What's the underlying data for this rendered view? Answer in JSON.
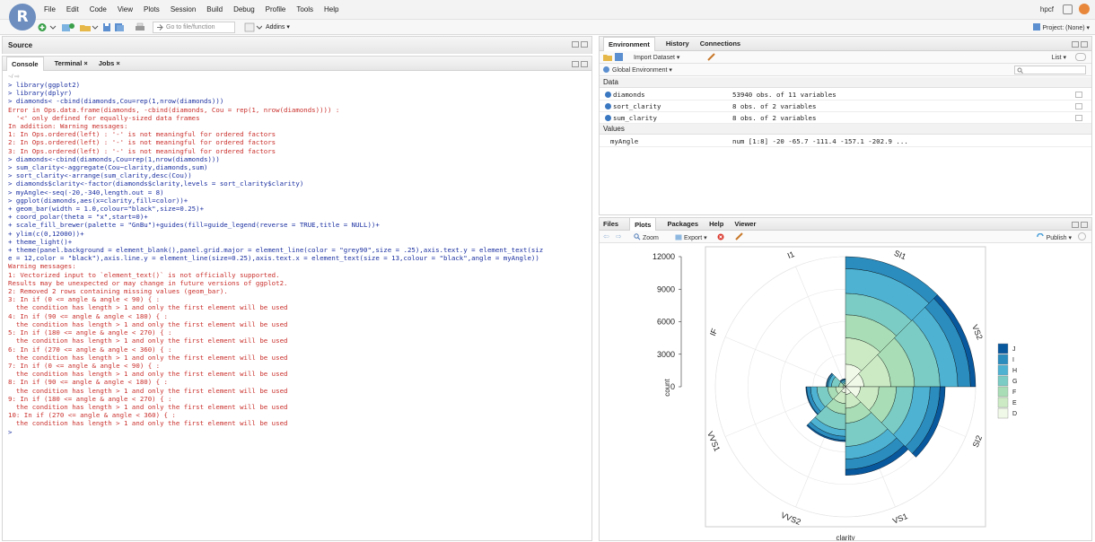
{
  "app": {
    "logo_letter": "R"
  },
  "menubar": {
    "items": [
      "File",
      "Edit",
      "Code",
      "View",
      "Plots",
      "Session",
      "Build",
      "Debug",
      "Profile",
      "Tools",
      "Help"
    ],
    "user": "hpcf"
  },
  "toolbar": {
    "goto_placeholder": "Go to file/function",
    "addins_label": "Addins ▾",
    "project_label": "Project: (None) ▾"
  },
  "source_pane": {
    "title": "Source"
  },
  "console_pane": {
    "tabs": [
      "Console",
      "Terminal ×",
      "Jobs ×"
    ],
    "path": "~/ ⇨",
    "lines": [
      {
        "t": "> library(ggplot2)",
        "c": "cmd"
      },
      {
        "t": "> library(dplyr)",
        "c": "cmd"
      },
      {
        "t": "> diamonds< -cbind(diamonds,Cou=rep(1,nrow(diamonds)))",
        "c": "cmd"
      },
      {
        "t": "Error in Ops.data.frame(diamonds, -cbind(diamonds, Cou = rep(1, nrow(diamonds)))) :",
        "c": "err"
      },
      {
        "t": "  '<' only defined for equally-sized data frames",
        "c": "err"
      },
      {
        "t": "In addition: Warning messages:",
        "c": "err"
      },
      {
        "t": "1: In Ops.ordered(left) : '-' is not meaningful for ordered factors",
        "c": "err"
      },
      {
        "t": "2: In Ops.ordered(left) : '-' is not meaningful for ordered factors",
        "c": "err"
      },
      {
        "t": "3: In Ops.ordered(left) : '-' is not meaningful for ordered factors",
        "c": "err"
      },
      {
        "t": "> diamonds<-cbind(diamonds,Cou=rep(1,nrow(diamonds)))",
        "c": "cmd"
      },
      {
        "t": "> sum_clarity<-aggregate(Cou~clarity,diamonds,sum)",
        "c": "cmd"
      },
      {
        "t": "> sort_clarity<-arrange(sum_clarity,desc(Cou))",
        "c": "cmd"
      },
      {
        "t": "> diamonds$clarity<-factor(diamonds$clarity,levels = sort_clarity$clarity)",
        "c": "cmd"
      },
      {
        "t": "> myAngle<-seq(-20,-340,length.out = 8)",
        "c": "cmd"
      },
      {
        "t": "> ggplot(diamonds,aes(x=clarity,fill=color))+",
        "c": "cmd"
      },
      {
        "t": "+ geom_bar(width = 1.0,colour=\"black\",size=0.25)+",
        "c": "cmd"
      },
      {
        "t": "+ coord_polar(theta = \"x\",start=0)+",
        "c": "cmd"
      },
      {
        "t": "+ scale_fill_brewer(palette = \"GnBu\")+guides(fill=guide_legend(reverse = TRUE,title = NULL))+",
        "c": "cmd"
      },
      {
        "t": "+ ylim(c(0,12000))+",
        "c": "cmd"
      },
      {
        "t": "+ theme_light()+",
        "c": "cmd"
      },
      {
        "t": "+ theme(panel.background = element_blank(),panel.grid.major = element_line(color = \"grey90\",size = .25),axis.text.y = element_text(siz",
        "c": "cmd"
      },
      {
        "t": "e = 12,color = \"black\"),axis.line.y = element_line(size=0.25),axis.text.x = element_text(size = 13,colour = \"black\",angle = myAngle))",
        "c": "cmd"
      },
      {
        "t": "Warning messages:",
        "c": "err"
      },
      {
        "t": "1: Vectorized input to `element_text()` is not officially supported.",
        "c": "err"
      },
      {
        "t": "Results may be unexpected or may change in future versions of ggplot2.",
        "c": "err"
      },
      {
        "t": "2: Removed 2 rows containing missing values (geom_bar).",
        "c": "err"
      },
      {
        "t": "3: In if (0 <= angle & angle < 90) { :",
        "c": "err"
      },
      {
        "t": "  the condition has length > 1 and only the first element will be used",
        "c": "err"
      },
      {
        "t": "4: In if (90 <= angle & angle < 180) { :",
        "c": "err"
      },
      {
        "t": "  the condition has length > 1 and only the first element will be used",
        "c": "err"
      },
      {
        "t": "5: In if (180 <= angle & angle < 270) { :",
        "c": "err"
      },
      {
        "t": "  the condition has length > 1 and only the first element will be used",
        "c": "err"
      },
      {
        "t": "6: In if (270 <= angle & angle < 360) { :",
        "c": "err"
      },
      {
        "t": "  the condition has length > 1 and only the first element will be used",
        "c": "err"
      },
      {
        "t": "7: In if (0 <= angle & angle < 90) { :",
        "c": "err"
      },
      {
        "t": "  the condition has length > 1 and only the first element will be used",
        "c": "err"
      },
      {
        "t": "8: In if (90 <= angle & angle < 180) { :",
        "c": "err"
      },
      {
        "t": "  the condition has length > 1 and only the first element will be used",
        "c": "err"
      },
      {
        "t": "9: In if (180 <= angle & angle < 270) { :",
        "c": "err"
      },
      {
        "t": "  the condition has length > 1 and only the first element will be used",
        "c": "err"
      },
      {
        "t": "10: In if (270 <= angle & angle < 360) { :",
        "c": "err"
      },
      {
        "t": "  the condition has length > 1 and only the first element will be used",
        "c": "err"
      },
      {
        "t": ">",
        "c": "cursor"
      }
    ]
  },
  "env_pane": {
    "tabs": [
      "Environment",
      "History",
      "Connections"
    ],
    "import_label": "Import Dataset ▾",
    "list_label": "List ▾",
    "scope_label": "Global Environment ▾",
    "data_heading": "Data",
    "values_heading": "Values",
    "data_rows": [
      {
        "name": "diamonds",
        "value": "53940 obs. of 11 variables"
      },
      {
        "name": "sort_clarity",
        "value": "8 obs. of 2 variables"
      },
      {
        "name": "sum_clarity",
        "value": "8 obs. of 2 variables"
      }
    ],
    "value_rows": [
      {
        "name": "myAngle",
        "value": "num [1:8] -20 -65.7 -111.4 -157.1 -202.9 ..."
      }
    ]
  },
  "plots_pane": {
    "tabs": [
      "Files",
      "Plots",
      "Packages",
      "Help",
      "Viewer"
    ],
    "zoom_label": "Zoom",
    "export_label": "Export ▾",
    "publish_label": "Publish ▾"
  },
  "chart_data": {
    "type": "bar",
    "coord": "polar",
    "categories": [
      "SI1",
      "VS2",
      "SI2",
      "VS1",
      "VVS2",
      "VVS1",
      "IF",
      "I1"
    ],
    "colors_order_inner_to_outer": [
      "D",
      "E",
      "F",
      "G",
      "H",
      "I",
      "J"
    ],
    "series": [
      {
        "name": "D",
        "values": [
          2083,
          1697,
          1370,
          705,
          553,
          252,
          73,
          42
        ]
      },
      {
        "name": "E",
        "values": [
          2426,
          2470,
          1713,
          1281,
          991,
          656,
          158,
          102
        ]
      },
      {
        "name": "F",
        "values": [
          2131,
          2201,
          1609,
          1364,
          975,
          734,
          385,
          143
        ]
      },
      {
        "name": "G",
        "values": [
          1976,
          2347,
          1548,
          2148,
          1443,
          999,
          681,
          150
        ]
      },
      {
        "name": "H",
        "values": [
          2275,
          1643,
          1563,
          1169,
          608,
          585,
          299,
          162
        ]
      },
      {
        "name": "I",
        "values": [
          1424,
          1169,
          912,
          962,
          365,
          355,
          143,
          92
        ]
      },
      {
        "name": "J",
        "values": [
          750,
          731,
          479,
          542,
          131,
          74,
          51,
          50
        ]
      }
    ],
    "ylim": [
      0,
      12000
    ],
    "yticks": [
      0,
      3000,
      6000,
      9000,
      12000
    ],
    "xlabel": "clarity",
    "ylabel": "count",
    "legend_entries": [
      "J",
      "I",
      "H",
      "G",
      "F",
      "E",
      "D"
    ],
    "legend_placement": "right",
    "palette": {
      "D": "#f0f9e8",
      "E": "#ccebc5",
      "F": "#a8ddb5",
      "G": "#7bccc4",
      "H": "#4eb3d3",
      "I": "#2b8cbe",
      "J": "#08589e"
    }
  }
}
